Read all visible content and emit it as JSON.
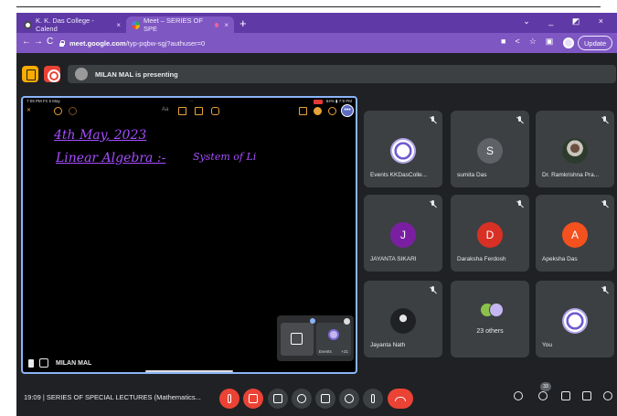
{
  "browser": {
    "tabs": [
      {
        "title": "K. K. Das College - Calend",
        "active": false
      },
      {
        "title": "Meet – SERIES OF SPE",
        "active": true
      }
    ],
    "new_tab_symbol": "+",
    "window_controls": "⌄ _ ◩ ×",
    "url_host": "meet.google.com",
    "url_path": "/typ-pqbw-sgj?authuser=0",
    "update_label": "Update",
    "accent": "#7e57c2"
  },
  "meet": {
    "presenting_text": "MILAN MAL is presenting",
    "screen": {
      "status_left": "7:09 PM  Fri 5 May",
      "status_center": "···",
      "status_right": "64% ▮ 7:9 PM",
      "toolbar_text": "Aa",
      "ink_lines": [
        "4th May, 2023",
        "Linear Algebra :-",
        "System of Li"
      ],
      "pip_label": "Events",
      "pip_count": "+21",
      "presenter_name": "MILAN MAL"
    },
    "participants": [
      {
        "name": "Events KKDasColle...",
        "avatar": "seal",
        "initial": ""
      },
      {
        "name": "sumita Das",
        "avatar": "letter",
        "initial": "S",
        "color": "#5f6368"
      },
      {
        "name": "Dr. Ramkrishna Pra...",
        "avatar": "photo",
        "initial": ""
      },
      {
        "name": "JAYANTA SIKARI",
        "avatar": "letter",
        "initial": "J",
        "color": "#7b1fa2"
      },
      {
        "name": "Daraksha Ferdosh",
        "avatar": "letter",
        "initial": "D",
        "color": "#d93025"
      },
      {
        "name": "Apeksha Das",
        "avatar": "letter",
        "initial": "A",
        "color": "#f4511e"
      },
      {
        "name": "Jayanta Nath",
        "avatar": "dark",
        "initial": ""
      },
      {
        "name": "",
        "avatar": "stack",
        "initial": "",
        "others_label": "23 others"
      },
      {
        "name": "You",
        "avatar": "seal",
        "initial": ""
      }
    ],
    "meeting_time": "19:09",
    "meeting_title": "SERIES OF SPECIAL LECTURES (Mathematics...",
    "participant_count": "33"
  }
}
